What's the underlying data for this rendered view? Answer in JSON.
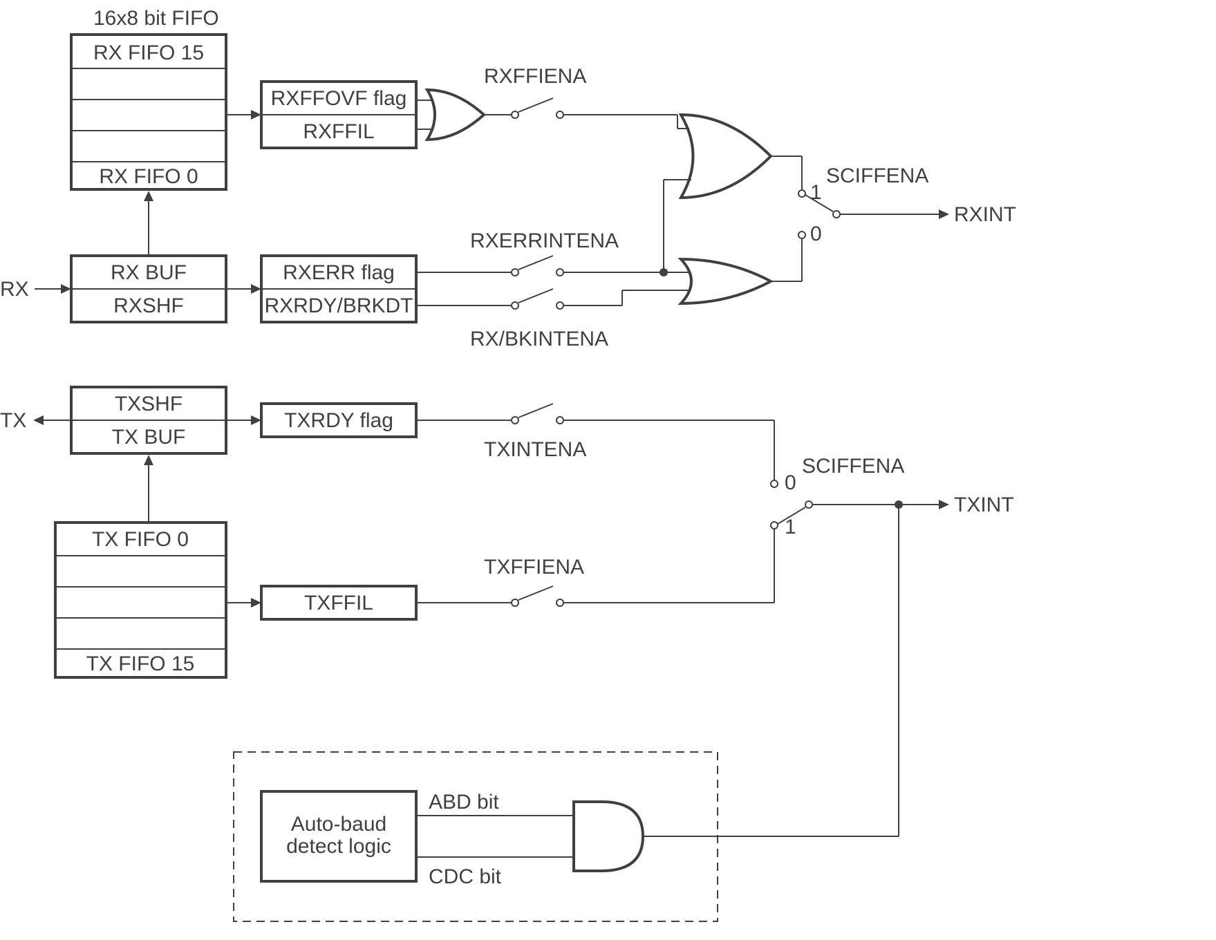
{
  "title": "16x8 bit FIFO",
  "rx_fifo_top": "RX FIFO 15",
  "rx_fifo_bot": "RX FIFO 0",
  "rx_buf": "RX BUF",
  "rx_shf": "RXSHF",
  "rx_in": "RX",
  "rxffovf": "RXFFOVF flag",
  "rxffil": "RXFFIL",
  "rxffiena": "RXFFIENA",
  "rxerr": "RXERR flag",
  "rxrdy": "RXRDY/BRKDT",
  "rxerrintena": "RXERRINTENA",
  "rxbkintena": "RX/BKINTENA",
  "sciffena1": "SCIFFENA",
  "sciffena2": "SCIFFENA",
  "rxint": "RXINT",
  "txint": "TXINT",
  "txshf": "TXSHF",
  "txbuf": "TX BUF",
  "tx_out": "TX",
  "txrdy": "TXRDY flag",
  "txintena": "TXINTENA",
  "txffil": "TXFFIL",
  "txffiena": "TXFFIENA",
  "tx_fifo_top": "TX FIFO 0",
  "tx_fifo_bot": "TX FIFO 15",
  "autobaud": "Auto-baud",
  "autobaud2": "detect logic",
  "abd": "ABD bit",
  "cdc": "CDC bit",
  "one": "1",
  "zero": "0"
}
